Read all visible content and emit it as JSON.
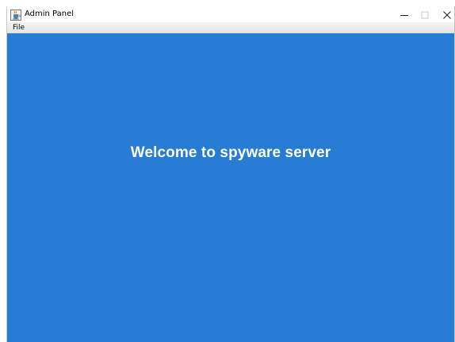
{
  "window": {
    "title": "Admin Panel",
    "icon": "java-cup-icon"
  },
  "title_bar_controls": {
    "minimize_icon": "minimize-icon",
    "maximize_icon": "maximize-icon",
    "close_icon": "close-icon"
  },
  "menubar": {
    "items": [
      {
        "label": "File"
      }
    ]
  },
  "content": {
    "background_color": "#277dd4",
    "text_color": "#ffffff",
    "welcome_text": "Welcome to spyware server"
  }
}
